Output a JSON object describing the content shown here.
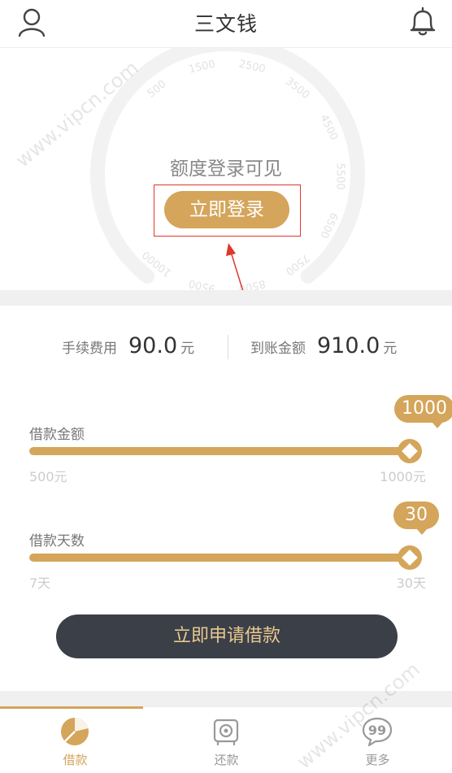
{
  "header": {
    "title": "三文钱"
  },
  "gauge": {
    "prompt": "额度登录可见",
    "login_button": "立即登录",
    "ticks": [
      "500",
      "1500",
      "2500",
      "3500",
      "4500",
      "5500",
      "6500",
      "7500",
      "8500",
      "9500",
      "10000"
    ]
  },
  "fees": {
    "fee_label": "手续费用",
    "fee_value": "90.0",
    "fee_unit": "元",
    "arrival_label": "到账金额",
    "arrival_value": "910.0",
    "arrival_unit": "元"
  },
  "amount_slider": {
    "label": "借款金额",
    "value": "1000",
    "min_label": "500元",
    "max_label": "1000元",
    "fraction": 1.0
  },
  "days_slider": {
    "label": "借款天数",
    "value": "30",
    "min_label": "7天",
    "max_label": "30天",
    "fraction": 1.0
  },
  "apply_button": "立即申请借款",
  "tabs": [
    {
      "label": "借款",
      "icon": "pie-chart-icon",
      "active": true
    },
    {
      "label": "还款",
      "icon": "safe-icon",
      "active": false
    },
    {
      "label": "更多",
      "icon": "quote-bubble-icon",
      "active": false
    }
  ],
  "watermark": "www.vipcn.com",
  "colors": {
    "accent": "#d4a55a",
    "dark_button": "#3b3f48",
    "highlight": "#e0372b"
  }
}
